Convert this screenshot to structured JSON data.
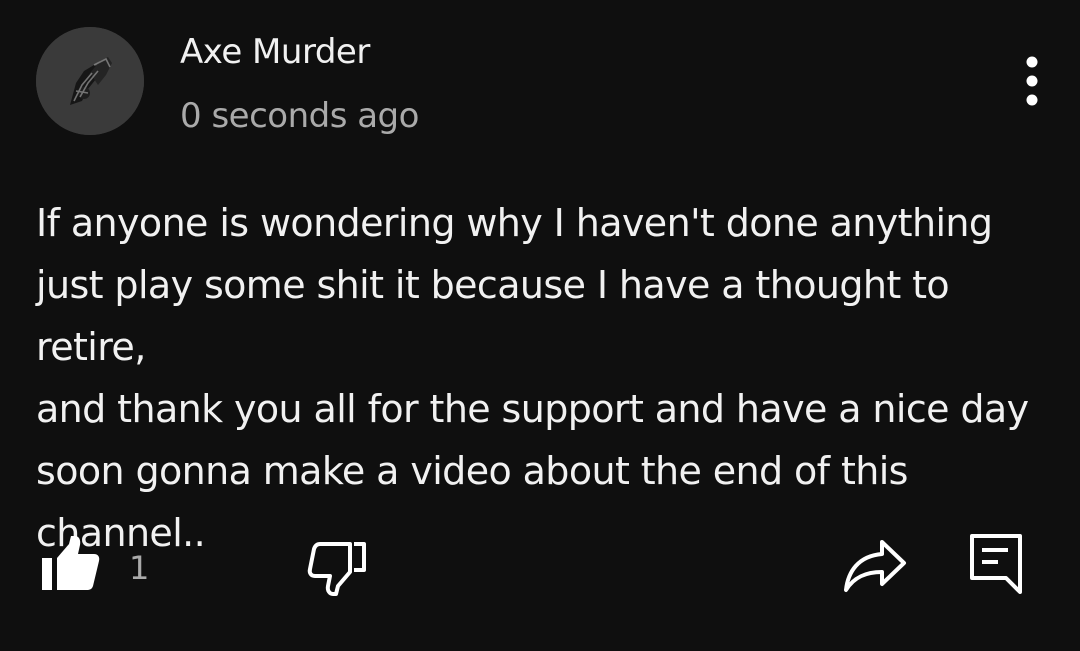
{
  "comment": {
    "author": "Axe Murder",
    "timestamp": "0 seconds ago",
    "text": "If anyone is wondering why I haven't done anything\njust play some shit it because I have a thought to retire,\nand thank you all for the support and have a nice day\nsoon gonna make a video about the end of this\nchannel..",
    "like_count": "1"
  },
  "icons": {
    "avatar": "avatar-image",
    "menu": "more-vertical-icon",
    "like": "thumbs-up-filled-icon",
    "dislike": "thumbs-down-outline-icon",
    "share": "share-arrow-icon",
    "reply": "comment-reply-icon"
  },
  "colors": {
    "background": "#0f0f0f",
    "primary_text": "#f1f1f1",
    "secondary_text": "#aaaaaa"
  }
}
